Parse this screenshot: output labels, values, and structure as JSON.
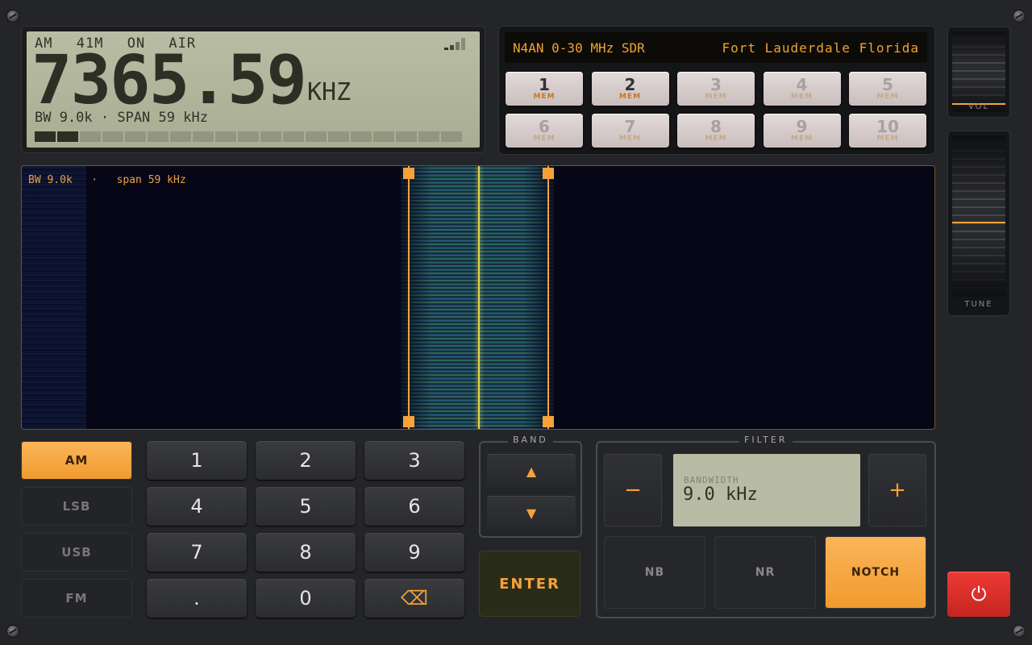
{
  "display": {
    "mode": "AM",
    "band": "41M",
    "status": "ON AIR",
    "frequency": "7365.59",
    "unit": "KHZ",
    "bw_span": "BW 9.0k · SPAN 59 kHz",
    "signal_bars": 4,
    "meter_segments_total": 19,
    "meter_segments_on": 2
  },
  "memory_panel": {
    "station": "N4AN 0-30 MHz SDR",
    "location": "Fort Lauderdale Florida",
    "buttons": [
      {
        "num": "1",
        "label": "MEM",
        "active": true
      },
      {
        "num": "2",
        "label": "MEM",
        "active": true
      },
      {
        "num": "3",
        "label": "MEM",
        "active": false
      },
      {
        "num": "4",
        "label": "MEM",
        "active": false
      },
      {
        "num": "5",
        "label": "MEM",
        "active": false
      },
      {
        "num": "6",
        "label": "MEM",
        "active": false
      },
      {
        "num": "7",
        "label": "MEM",
        "active": false
      },
      {
        "num": "8",
        "label": "MEM",
        "active": false
      },
      {
        "num": "9",
        "label": "MEM",
        "active": false
      },
      {
        "num": "10",
        "label": "MEM",
        "active": false
      }
    ]
  },
  "waterfall": {
    "label": "BW 9.0k   ·   span 59 kHz"
  },
  "sliders": {
    "vol_label": "VOL",
    "tune_label": "TUNE"
  },
  "modes": [
    {
      "label": "AM",
      "active": true
    },
    {
      "label": "LSB",
      "active": false
    },
    {
      "label": "USB",
      "active": false
    },
    {
      "label": "FM",
      "active": false
    }
  ],
  "keypad": [
    "1",
    "2",
    "3",
    "4",
    "5",
    "6",
    "7",
    "8",
    "9",
    ".",
    "0",
    "⌫"
  ],
  "band": {
    "title": "BAND",
    "up": "▲",
    "down": "▼"
  },
  "enter_label": "ENTER",
  "filter": {
    "title": "FILTER",
    "minus": "−",
    "plus": "+",
    "bw_label": "BANDWIDTH",
    "bw_value": "9.0 kHz",
    "nb": "NB",
    "nr": "NR",
    "notch": "NOTCH"
  },
  "power_icon": "⏻",
  "colors": {
    "accent": "#f5a23a",
    "lcd": "#b9bda4",
    "power": "#e2302b"
  }
}
